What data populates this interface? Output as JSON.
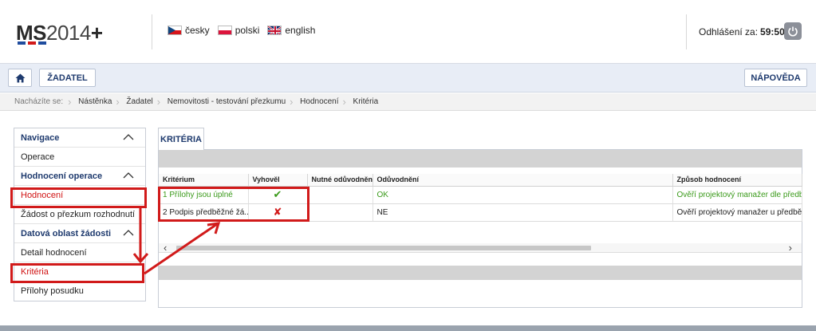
{
  "header": {
    "logo_bold": "MS",
    "logo_thin": "2014",
    "logo_plus": "+",
    "logo_stripe_colors": [
      "#1f4c9e",
      "#d11a1a",
      "#1f4c9e"
    ],
    "languages": [
      {
        "label": "česky",
        "icon": "flag-cz-icon"
      },
      {
        "label": "polski",
        "icon": "flag-pl-icon"
      },
      {
        "label": "english",
        "icon": "flag-gb-icon"
      }
    ],
    "logout_label": "Odhlášení za:",
    "logout_time": "59:50",
    "power_icon": "power-icon"
  },
  "toolbar": {
    "home_icon": "home-icon",
    "zadatel_label": "ŽADATEL",
    "help_label": "NÁPOVĚDA"
  },
  "breadcrumb": {
    "label": "Nacházíte se:",
    "items": [
      "Nástěnka",
      "Žadatel",
      "Nemovitosti - testování přezkumu",
      "Hodnocení",
      "Kritéria"
    ]
  },
  "sidebar": {
    "items": [
      {
        "label": "Navigace",
        "type": "header"
      },
      {
        "label": "Operace",
        "type": "item"
      },
      {
        "label": "Hodnocení operace",
        "type": "header"
      },
      {
        "label": "Hodnocení",
        "type": "item",
        "active": true
      },
      {
        "label": "Žádost o přezkum rozhodnutí",
        "type": "item"
      },
      {
        "label": "Datová oblast žádosti",
        "type": "header"
      },
      {
        "label": "Detail hodnocení",
        "type": "item"
      },
      {
        "label": "Kritéria",
        "type": "item",
        "active": true
      },
      {
        "label": "Přílohy posudku",
        "type": "item"
      }
    ]
  },
  "main": {
    "tab_label": "KRITÉRIA",
    "table": {
      "columns": [
        "Kritérium",
        "Vyhověl",
        "Nutné odůvodnění",
        "Odůvodnění",
        "Způsob hodnocení"
      ],
      "rows": [
        {
          "kriterium": "1 Přílohy jsou úplné",
          "vyhovel": "✔",
          "nutne": "",
          "oduvodneni": "OK",
          "zpusob": "Ověří projektový manažer dle předběž",
          "green": true
        },
        {
          "kriterium": "2 Podpis předběžné žá...",
          "vyhovel": "✘",
          "nutne": "",
          "oduvodneni": "NE",
          "zpusob": "Ověří projektový manažer u předběžné",
          "green": false
        }
      ]
    },
    "scroll_left": "‹",
    "scroll_right": "›"
  },
  "colors": {
    "accent_blue": "#1e3a6e",
    "highlight_red": "#d11a1a",
    "ok_green": "#3a9a1a"
  }
}
